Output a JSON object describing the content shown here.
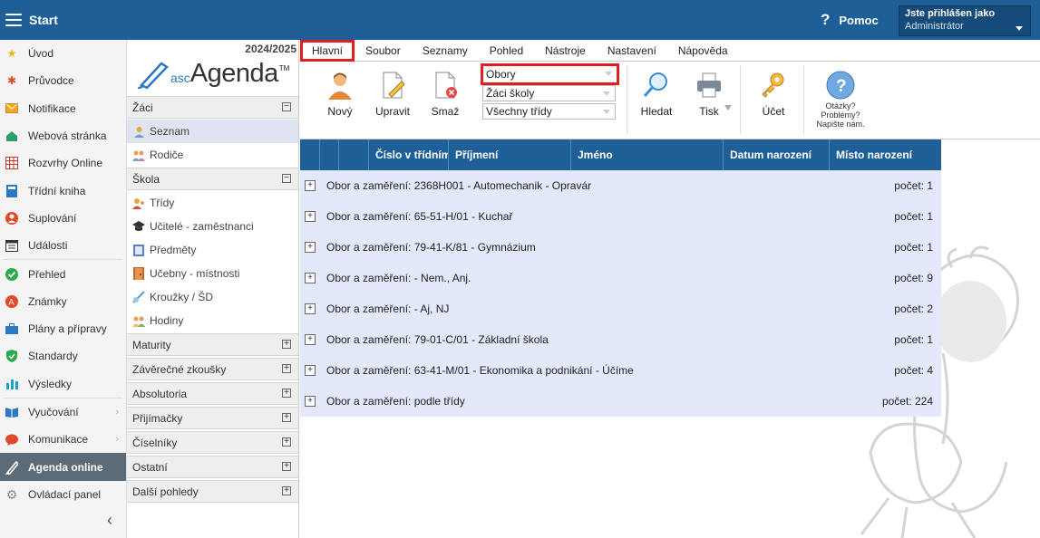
{
  "topbar": {
    "start_label": "Start",
    "help_label": "Pomoc",
    "user_line1": "Jste přihlášen jako",
    "user_line2": "Administrátor"
  },
  "leftnav": {
    "items": [
      {
        "label": "Úvod",
        "icon": "star-icon"
      },
      {
        "label": "Průvodce",
        "icon": "wand-icon"
      },
      {
        "label": "Notifikace",
        "icon": "envelope-icon"
      },
      {
        "label": "Webová stránka",
        "icon": "home-icon"
      },
      {
        "label": "Rozvrhy Online",
        "icon": "timetable-icon"
      },
      {
        "label": "Třídní kniha",
        "icon": "book-icon"
      },
      {
        "label": "Suplování",
        "icon": "person-icon"
      },
      {
        "label": "Události",
        "icon": "calendar-icon"
      },
      {
        "label": "Přehled",
        "icon": "check-circle-icon"
      },
      {
        "label": "Známky",
        "icon": "grade-icon"
      },
      {
        "label": "Plány a přípravy",
        "icon": "briefcase-icon"
      },
      {
        "label": "Standardy",
        "icon": "shield-icon"
      },
      {
        "label": "Výsledky",
        "icon": "bar-chart-icon"
      },
      {
        "label": "Vyučování",
        "icon": "open-book-icon"
      },
      {
        "label": "Komunikace",
        "icon": "chat-icon"
      },
      {
        "label": "Agenda online",
        "icon": "pen-icon"
      },
      {
        "label": "Ovládací panel",
        "icon": "gear-icon"
      }
    ]
  },
  "panel2": {
    "year": "2024/2025",
    "logo_asc": "asc",
    "logo_agenda": "Agenda",
    "logo_tm": "TM",
    "sections": {
      "zaci": "Žáci",
      "skola": "Škola",
      "maturity": "Maturity",
      "zaverecne": "Závěrečné zkoušky",
      "absolutoria": "Absolutoria",
      "prijimacky": "Přijímačky",
      "ciselniky": "Číselníky",
      "ostatni": "Ostatní",
      "dalsi": "Další pohledy"
    },
    "zaci_items": [
      "Seznam",
      "Rodiče"
    ],
    "skola_items": [
      "Třídy",
      "Učitelé - zaměstnanci",
      "Předměty",
      "Učebny - místnosti",
      "Kroužky / ŠD",
      "Hodiny"
    ]
  },
  "menubar": {
    "tabs": [
      "Hlavní",
      "Soubor",
      "Seznamy",
      "Pohled",
      "Nástroje",
      "Nastavení",
      "Nápověda"
    ]
  },
  "ribbon": {
    "novy": "Nový",
    "upravit": "Upravit",
    "smaz": "Smaž",
    "select1": "Obory",
    "select2": "Žáci školy",
    "select3": "Všechny třídy",
    "hledat": "Hledat",
    "tisk": "Tisk",
    "ucet": "Účet",
    "qa1": "Otázky?",
    "qa2": "Problémy?",
    "qa3": "Napište nám."
  },
  "grid": {
    "columns": [
      "Číslo v třídním",
      "Příjmení",
      "Jméno",
      "Datum narození",
      "Místo narození"
    ],
    "rows": [
      {
        "label": "Obor a zaměření: 2368H001 - Automechanik - Opravár",
        "count": "počet: 1"
      },
      {
        "label": "Obor a zaměření: 65-51-H/01 - Kuchař",
        "count": "počet: 1"
      },
      {
        "label": "Obor a zaměření: 79-41-K/81 - Gymnázium",
        "count": "počet: 1"
      },
      {
        "label": "Obor a zaměření: - Nem., Anj.",
        "count": "počet: 9"
      },
      {
        "label": "Obor a zaměření: - Aj, NJ",
        "count": "počet: 2"
      },
      {
        "label": "Obor a zaměření: 79-01-C/01 - Základní škola",
        "count": "počet: 1"
      },
      {
        "label": "Obor a zaměření: 63-41-M/01 - Ekonomika a podnikání - Účíme",
        "count": "počet: 4"
      },
      {
        "label": "Obor a zaměření: podle třídy",
        "count": "počet: 224"
      }
    ]
  }
}
